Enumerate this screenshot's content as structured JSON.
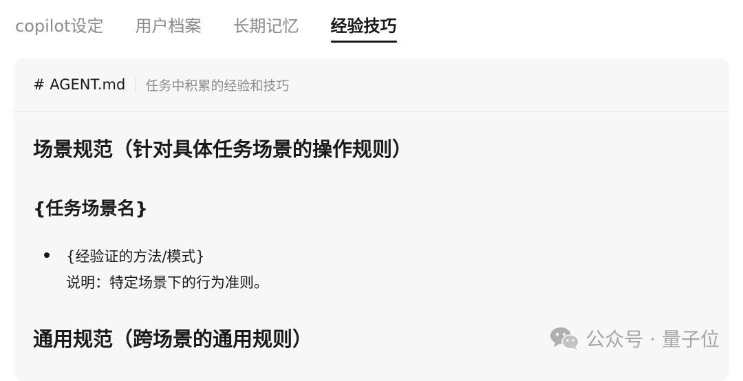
{
  "tabs": [
    {
      "label": "copilot设定",
      "active": false
    },
    {
      "label": "用户档案",
      "active": false
    },
    {
      "label": "长期记忆",
      "active": false
    },
    {
      "label": "经验技巧",
      "active": true
    }
  ],
  "file": {
    "name": "# AGENT.md",
    "description": "任务中积累的经验和技巧"
  },
  "document": {
    "section1_heading": "场景规范（针对具体任务场景的操作规则）",
    "subsection_heading": "{任务场景名}",
    "bullet_line1": "{经验证的方法/模式}",
    "bullet_line2": "说明：特定场景下的行为准则。",
    "section2_heading": "通用规范（跨场景的通用规则）"
  },
  "watermark": {
    "icon": "wechat-icon",
    "text": "公众号 · 量子位"
  }
}
